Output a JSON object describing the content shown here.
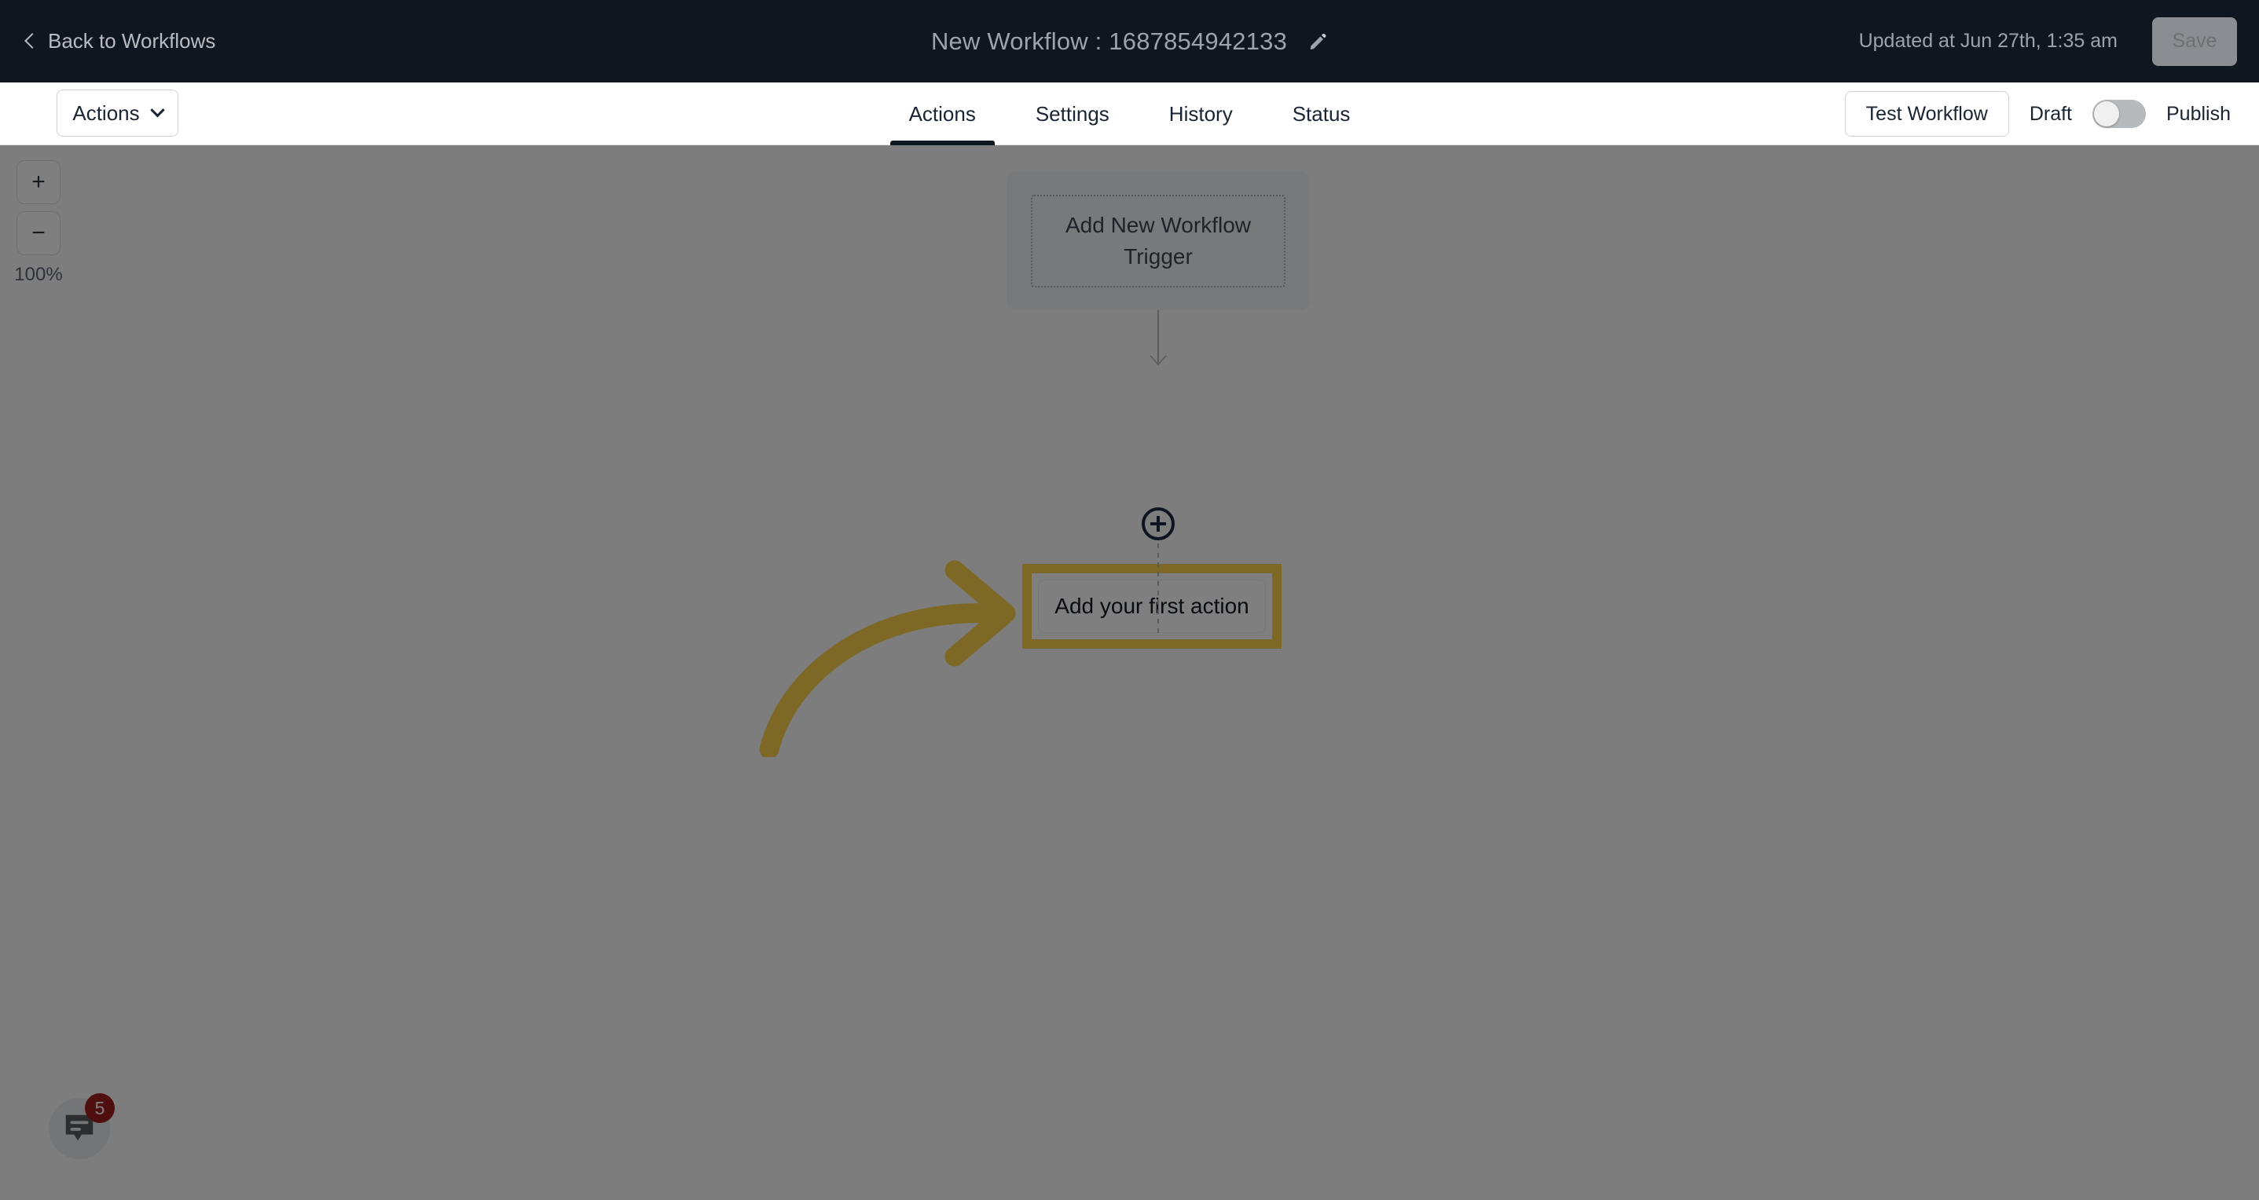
{
  "header": {
    "back_label": "Back to Workflows",
    "back_icon": "chevron-left-icon",
    "title": "New Workflow : 1687854942133",
    "edit_icon": "pencil-icon",
    "updated_at": "Updated at Jun 27th, 1:35 am",
    "save_label": "Save"
  },
  "toolbar": {
    "actions_dropdown_label": "Actions",
    "dropdown_icon": "chevron-down-icon",
    "tabs": [
      {
        "label": "Actions",
        "active": true
      },
      {
        "label": "Settings",
        "active": false
      },
      {
        "label": "History",
        "active": false
      },
      {
        "label": "Status",
        "active": false
      }
    ],
    "test_workflow_label": "Test Workflow",
    "draft_label": "Draft",
    "publish_label": "Publish",
    "toggle_state": "off"
  },
  "canvas": {
    "zoom_in_label": "+",
    "zoom_out_label": "−",
    "zoom_level": "100%",
    "trigger_node_label": "Add New Workflow Trigger",
    "add_step_icon": "plus-circle-icon",
    "action_node_label": "Add your first action",
    "annotation_icon": "curved-arrow-icon"
  },
  "chat": {
    "icon": "chat-bubble-icon",
    "badge_count": "5"
  },
  "colors": {
    "topbar_bg": "#0e1620",
    "highlight": "#fbd14d",
    "accent_dark": "#1d2b42",
    "badge_red": "#a01f1f"
  }
}
